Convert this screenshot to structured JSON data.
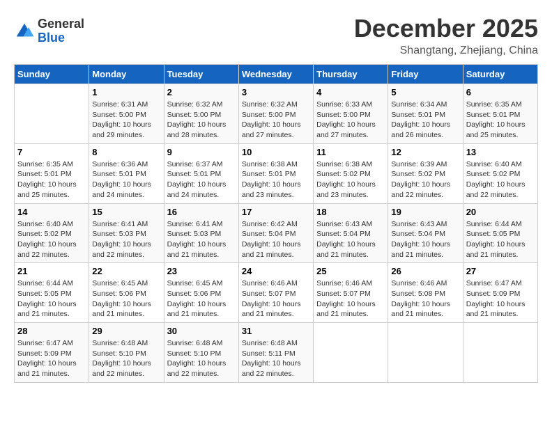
{
  "header": {
    "logo_line1": "General",
    "logo_line2": "Blue",
    "month": "December 2025",
    "location": "Shangtang, Zhejiang, China"
  },
  "weekdays": [
    "Sunday",
    "Monday",
    "Tuesday",
    "Wednesday",
    "Thursday",
    "Friday",
    "Saturday"
  ],
  "weeks": [
    [
      {
        "day": "",
        "info": ""
      },
      {
        "day": "1",
        "info": "Sunrise: 6:31 AM\nSunset: 5:00 PM\nDaylight: 10 hours\nand 29 minutes."
      },
      {
        "day": "2",
        "info": "Sunrise: 6:32 AM\nSunset: 5:00 PM\nDaylight: 10 hours\nand 28 minutes."
      },
      {
        "day": "3",
        "info": "Sunrise: 6:32 AM\nSunset: 5:00 PM\nDaylight: 10 hours\nand 27 minutes."
      },
      {
        "day": "4",
        "info": "Sunrise: 6:33 AM\nSunset: 5:00 PM\nDaylight: 10 hours\nand 27 minutes."
      },
      {
        "day": "5",
        "info": "Sunrise: 6:34 AM\nSunset: 5:01 PM\nDaylight: 10 hours\nand 26 minutes."
      },
      {
        "day": "6",
        "info": "Sunrise: 6:35 AM\nSunset: 5:01 PM\nDaylight: 10 hours\nand 25 minutes."
      }
    ],
    [
      {
        "day": "7",
        "info": "Sunrise: 6:35 AM\nSunset: 5:01 PM\nDaylight: 10 hours\nand 25 minutes."
      },
      {
        "day": "8",
        "info": "Sunrise: 6:36 AM\nSunset: 5:01 PM\nDaylight: 10 hours\nand 24 minutes."
      },
      {
        "day": "9",
        "info": "Sunrise: 6:37 AM\nSunset: 5:01 PM\nDaylight: 10 hours\nand 24 minutes."
      },
      {
        "day": "10",
        "info": "Sunrise: 6:38 AM\nSunset: 5:01 PM\nDaylight: 10 hours\nand 23 minutes."
      },
      {
        "day": "11",
        "info": "Sunrise: 6:38 AM\nSunset: 5:02 PM\nDaylight: 10 hours\nand 23 minutes."
      },
      {
        "day": "12",
        "info": "Sunrise: 6:39 AM\nSunset: 5:02 PM\nDaylight: 10 hours\nand 22 minutes."
      },
      {
        "day": "13",
        "info": "Sunrise: 6:40 AM\nSunset: 5:02 PM\nDaylight: 10 hours\nand 22 minutes."
      }
    ],
    [
      {
        "day": "14",
        "info": "Sunrise: 6:40 AM\nSunset: 5:02 PM\nDaylight: 10 hours\nand 22 minutes."
      },
      {
        "day": "15",
        "info": "Sunrise: 6:41 AM\nSunset: 5:03 PM\nDaylight: 10 hours\nand 22 minutes."
      },
      {
        "day": "16",
        "info": "Sunrise: 6:41 AM\nSunset: 5:03 PM\nDaylight: 10 hours\nand 21 minutes."
      },
      {
        "day": "17",
        "info": "Sunrise: 6:42 AM\nSunset: 5:04 PM\nDaylight: 10 hours\nand 21 minutes."
      },
      {
        "day": "18",
        "info": "Sunrise: 6:43 AM\nSunset: 5:04 PM\nDaylight: 10 hours\nand 21 minutes."
      },
      {
        "day": "19",
        "info": "Sunrise: 6:43 AM\nSunset: 5:04 PM\nDaylight: 10 hours\nand 21 minutes."
      },
      {
        "day": "20",
        "info": "Sunrise: 6:44 AM\nSunset: 5:05 PM\nDaylight: 10 hours\nand 21 minutes."
      }
    ],
    [
      {
        "day": "21",
        "info": "Sunrise: 6:44 AM\nSunset: 5:05 PM\nDaylight: 10 hours\nand 21 minutes."
      },
      {
        "day": "22",
        "info": "Sunrise: 6:45 AM\nSunset: 5:06 PM\nDaylight: 10 hours\nand 21 minutes."
      },
      {
        "day": "23",
        "info": "Sunrise: 6:45 AM\nSunset: 5:06 PM\nDaylight: 10 hours\nand 21 minutes."
      },
      {
        "day": "24",
        "info": "Sunrise: 6:46 AM\nSunset: 5:07 PM\nDaylight: 10 hours\nand 21 minutes."
      },
      {
        "day": "25",
        "info": "Sunrise: 6:46 AM\nSunset: 5:07 PM\nDaylight: 10 hours\nand 21 minutes."
      },
      {
        "day": "26",
        "info": "Sunrise: 6:46 AM\nSunset: 5:08 PM\nDaylight: 10 hours\nand 21 minutes."
      },
      {
        "day": "27",
        "info": "Sunrise: 6:47 AM\nSunset: 5:09 PM\nDaylight: 10 hours\nand 21 minutes."
      }
    ],
    [
      {
        "day": "28",
        "info": "Sunrise: 6:47 AM\nSunset: 5:09 PM\nDaylight: 10 hours\nand 21 minutes."
      },
      {
        "day": "29",
        "info": "Sunrise: 6:48 AM\nSunset: 5:10 PM\nDaylight: 10 hours\nand 22 minutes."
      },
      {
        "day": "30",
        "info": "Sunrise: 6:48 AM\nSunset: 5:10 PM\nDaylight: 10 hours\nand 22 minutes."
      },
      {
        "day": "31",
        "info": "Sunrise: 6:48 AM\nSunset: 5:11 PM\nDaylight: 10 hours\nand 22 minutes."
      },
      {
        "day": "",
        "info": ""
      },
      {
        "day": "",
        "info": ""
      },
      {
        "day": "",
        "info": ""
      }
    ]
  ]
}
